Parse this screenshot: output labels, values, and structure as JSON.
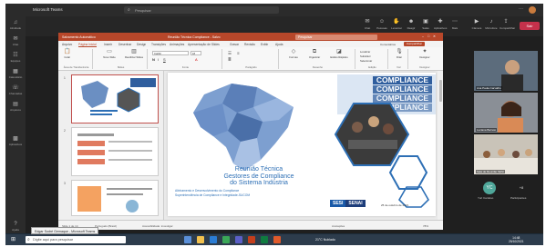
{
  "teams": {
    "window_title": "Microsoft Teams",
    "search_placeholder": "Pesquisar",
    "rail": [
      {
        "icon": "activity-icon",
        "label": "Atividade"
      },
      {
        "icon": "chat-icon",
        "label": "Chat"
      },
      {
        "icon": "teams-icon",
        "label": "Equipes"
      },
      {
        "icon": "calendar-icon",
        "label": "Calendário"
      },
      {
        "icon": "calls-icon",
        "label": "Chamadas"
      },
      {
        "icon": "files-icon",
        "label": "Arquivos"
      },
      {
        "icon": "apps-icon",
        "label": "Aplicativos"
      },
      {
        "icon": "help-icon",
        "label": "Ajuda"
      }
    ],
    "call_tools": [
      {
        "icon": "chat-icon",
        "label": "Chat"
      },
      {
        "icon": "people-icon",
        "label": "Pessoas"
      },
      {
        "icon": "raise-hand-icon",
        "label": "Levantar"
      },
      {
        "icon": "reactions-icon",
        "label": "Reagir"
      },
      {
        "icon": "rooms-icon",
        "label": "Salas"
      },
      {
        "icon": "apps-icon",
        "label": "Aplicativos"
      },
      {
        "icon": "more-icon",
        "label": "Mais"
      },
      {
        "icon": "camera-icon",
        "label": "Câmera"
      },
      {
        "icon": "mic-icon",
        "label": "Microfone"
      },
      {
        "icon": "share-icon",
        "label": "Compartilhar"
      }
    ],
    "leave_label": "Sair"
  },
  "ppt": {
    "title_left": "Salvamento Automático",
    "file_name": "Reunião Técnica Compliance - Salvo",
    "search_placeholder": "Pesquisar",
    "tabs": [
      "Arquivo",
      "Página Inicial",
      "Inserir",
      "Desenhar",
      "Design",
      "Transições",
      "Animações",
      "Apresentação de Slides",
      "Gravar",
      "Revisão",
      "Exibir",
      "Ajuda"
    ],
    "active_tab": "Página Inicial",
    "comments_label": "Comentários",
    "share_label": "Compartilhar",
    "ribbon_groups": [
      "Área de Transferência",
      "Slides",
      "Fonte",
      "Parágrafo",
      "Desenho",
      "Edição",
      "Voz",
      "Designer"
    ],
    "ribbon_buttons": {
      "paste": "Colar",
      "new_slide": "Novo Slide",
      "reuse": "Reutilizar Slides",
      "shapes": "Formas",
      "arrange": "Organizar",
      "quick_styles": "Estilos Rápidos",
      "find": "Localizar",
      "replace": "Substituir",
      "select": "Selecionar",
      "dictate": "Ditar",
      "designer": "Designer"
    },
    "font_name": "Calibri",
    "font_size": "18",
    "slide_numbers": [
      "1",
      "2",
      "3"
    ],
    "status": {
      "slide": "Slide 1 de 14",
      "language": "Português (Brasil)",
      "accessibility": "Acessibilidade: investigar",
      "notes": "Anotações",
      "zoom": "78%"
    }
  },
  "slide": {
    "compliance_words": [
      "COMPLIANCE",
      "COMPLIANCE",
      "COMPLIANCE",
      "COMPLIANCE"
    ],
    "title_lines": [
      "Reunião Técnica",
      "Gestores de Compliance",
      "do Sistema Indústria"
    ],
    "subtitle_lines": [
      "Alinhamento e Desenvolvimento do Compliance",
      "Superintendência de Compliance e Integridade-SUCOM"
    ],
    "logo_sesi": "SESI",
    "logo_senai": "SENAI",
    "date": "25 de outubro de 2021"
  },
  "participants": [
    {
      "name": "Ana Paula Carvalho"
    },
    {
      "name": "Luciana Barreto"
    },
    {
      "name": "Sala de Reunião SESI"
    }
  ],
  "avatar": {
    "initials": "YC",
    "name": "Yuri Cardoso"
  },
  "plus_count": "+8",
  "plus_label": "Participantes",
  "taskbar": {
    "search_placeholder": "Digite aqui para pesquisar",
    "tooltip": "Edgar Sodré Gemaque - Microsoft Teams",
    "weather": "21°C Nublado",
    "time": "14:48",
    "date": "25/10/2021"
  },
  "colors": {
    "ppt_accent": "#b7472a",
    "slide_blue": "#2d6fb5",
    "leave_red": "#c4314b",
    "teams_bg": "#1f1f1f"
  }
}
